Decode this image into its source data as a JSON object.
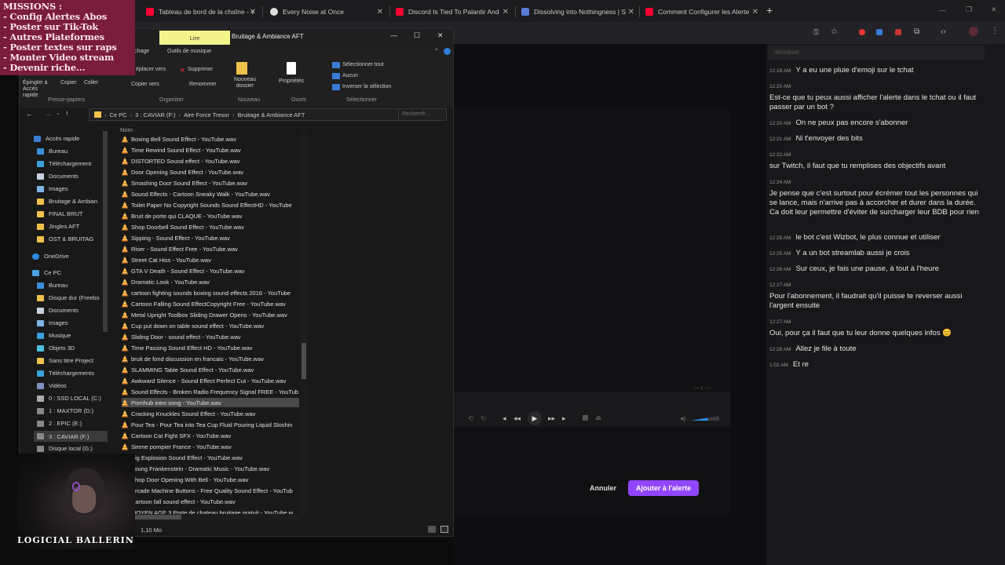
{
  "browser": {
    "tabs": [
      {
        "label": "Tableau de bord de la chaîne - Y",
        "color": "#ff0033"
      },
      {
        "label": "Every Noise at Once",
        "color": "#dddddd"
      },
      {
        "label": "Discord Is Tied To Palantir And",
        "color": "#ff0033"
      },
      {
        "label": "Dissolving into Nothingness | S",
        "color": "#5a7bd6"
      },
      {
        "label": "Comment Configurer les Alerte",
        "color": "#ff0033"
      }
    ],
    "new_tab": "+"
  },
  "missions": {
    "title": "MISSIONS :",
    "items": [
      "- Config Alertes Abos",
      "- Poster sur Tik-Tok",
      "- Autres Plateformes",
      "- Poster textes sur raps",
      "- Monter Video stream",
      "- Devenir riche..."
    ]
  },
  "explorer": {
    "title": "Bruitage & Ambiance AFT",
    "tab_lire": "Lire",
    "tab_partage": "chage",
    "tab_outils": "Outils de musique",
    "ribbon": {
      "epingler": "Épingler à Accès rapide",
      "copier": "Copier",
      "coller": "Coller",
      "deplacer": "éplacer vers",
      "copier_vers": "Copier vers",
      "supprimer": "Supprimer",
      "renommer": "Renommer",
      "nouveau_dossier": "Nouveau dossier",
      "proprietes": "Propriétés",
      "tout": "Sélectionner tout",
      "aucun": "Aucun",
      "inverser": "Inverser la sélection",
      "groups": [
        "Presse-papiers",
        "Organiser",
        "Nouveau",
        "Ouvrir",
        "Sélectionner"
      ]
    },
    "breadcrumb": [
      "Ce PC",
      "3 : CAVIAR (F:)",
      "Aire Force Tresor",
      "Bruitage & Ambiance AFT"
    ],
    "search_placeholder": "Recherch...",
    "column_name": "Nom",
    "nav": [
      "Accès rapide",
      "Bureau",
      "Téléchargement",
      "Documents",
      "Images",
      "Bruitage & Ambian",
      "FINAL BRUT",
      "Jingles AFT",
      "OST & BRUITAG",
      "OneDrive",
      "Ce PC",
      "Bureau",
      "Disque dur (Freebo",
      "Documents",
      "Images",
      "Musique",
      "Objets 3D",
      "Sans titre Project",
      "Téléchargements",
      "Vidéos",
      "0 : SSD LOCAL (C:)",
      "1 : MAXTOR (D:)",
      "2 : EPIC (E:)",
      "3 : CAVIAR (F:)",
      "Disque local (G:)"
    ],
    "files": [
      "Boxing Bell Sound Effect - YouTube.wav",
      "Time Rewind Sound Effect - YouTube.wav",
      "DISTORTED Sound effect - YouTube.wav",
      "Door Opening Sound Effect - YouTube.wav",
      "Smashing Door Sound Effect - YouTube.wav",
      "Sound Effects - Cartoon Sneaky Walk - YouTube.wav",
      "Toilet Paper No Copyright Sounds Sound EffectHD - YouTube",
      "Bruit de porte qui CLAQUE - YouTube.wav",
      "Shop Doorbell Sound Effect - YouTube.wav",
      "Sipping - Sound Effect - YouTube.wav",
      "Riser - Sound Effect Free - YouTube.wav",
      "Street Cat Hiss - YouTube.wav",
      "GTA V Death - Sound Effect - YouTube.wav",
      "Dramatic Look - YouTube.wav",
      "cartoon fighting sounds boxing sound effects 2016 - YouTube",
      "Cartoon Falling Sound EffectCopyright Free - YouTube.wav",
      "Metal Upright Toolbox Sliding Drawer Opens - YouTube.wav",
      "Cup put down on table sound effect - YouTube.wav",
      "Sliding Door - sound effect - YouTube.wav",
      "Time Passing Sound Effect HD - YouTube.wav",
      "bruit de fond discussion en francais - YouTube.wav",
      "SLAMMING Table Sound Effect - YouTube.wav",
      "Awkward Silence - Sound Effect Perfect Cut - YouTube.wav",
      "Sound Effects - Broken Radio Frequency Signal FREE - YouTub",
      "Pornhub intro song - YouTube.wav",
      "Cracking Knuckles Sound Effect - YouTube.wav",
      "Pour Tea - Pour Tea into Tea Cup Fluid Pouring Liquid Sloshin",
      "Cartoon Cat Fight SFX - YouTube.wav",
      "Sirene pompier France - YouTube.wav",
      "Big Explosion Sound Effect - YouTube.wav",
      "Young Frankenstein - Dramatic Music - YouTube.wav",
      "Shop Door Opening With Bell - YouTube.wav",
      "Arcade Machine Buttons - Free Quality Sound Effect - YouTub",
      "Cartoon fall sound effect - YouTube.wav",
      "MOYEN AGE 3 Porte de chateau bruitage gratuit - YouTube.w"
    ],
    "selected_index": 24,
    "status": "1,10 Mo"
  },
  "alert_dialog": {
    "cancel": "Annuler",
    "add": "Ajouter à l'alerte",
    "time": "-:-- / -:--"
  },
  "chat": {
    "input_placeholder": "décotiser",
    "lines": [
      {
        "time": "12:19 AM",
        "text": "Y a eu une pluie d'emoji sur le tchat"
      },
      {
        "time": "12:20 AM",
        "text": "Est-ce que tu peux aussi afficher l'alerte dans le tchat ou il faut passer par un bot ?"
      },
      {
        "time": "12:20 AM",
        "text": "On ne peux pas encore s'abonner"
      },
      {
        "time": "12:21 AM",
        "text": "Ni t'envoyer des bits"
      },
      {
        "time": "12:22 AM",
        "text": "sur Twitch, il faut que tu remplises des objectifs avant"
      },
      {
        "time": "12:24 AM",
        "text": "Je pense que c'est surtout pour écrémer tout les personnes qui se lance, mais n'arrive pas à accorcher et durer dans la durée. Ca doit leur permettre d'éviter de surcharger leur BDB pour rien"
      },
      {
        "time": "12:25 AM",
        "text": "le bot c'est Wizbot, le plus connue et utiliser"
      },
      {
        "time": "12:25 AM",
        "text": "Y a un bot streamlab aussi je crois"
      },
      {
        "time": "12:26 AM",
        "text": "Sur ceux, je fais une pause, à tout à l'heure"
      },
      {
        "time": "12:27 AM",
        "text": "Pour l'abonnement, il faudrait qu'il puisse te reverser aussi l'argent ensuite"
      },
      {
        "time": "12:27 AM",
        "text": "Oui, pour ça il faut que tu leur donne quelques infos 😊"
      },
      {
        "time": "12:28 AM",
        "text": "Allez je file à toute"
      },
      {
        "time": "1:02 AM",
        "text": "Et re"
      }
    ]
  },
  "webcam": {
    "name": "LOGICIAL BALLERIN"
  }
}
